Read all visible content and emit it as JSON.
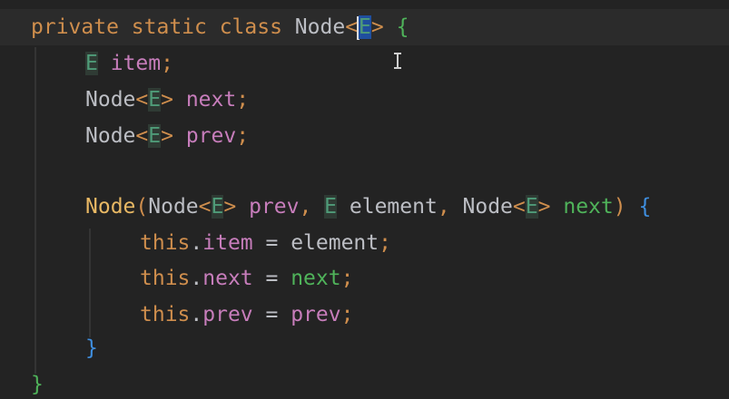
{
  "editor": {
    "lines": [
      [
        {
          "t": "private static class ",
          "c": "kw"
        },
        {
          "t": "Node",
          "c": "typ"
        },
        {
          "t": "<",
          "c": "lt"
        },
        {
          "t": "E",
          "c": "gen-sel"
        },
        {
          "t": ">",
          "c": "lt"
        },
        {
          "t": " ",
          "c": "typ"
        },
        {
          "t": "{",
          "c": "brace-g"
        }
      ],
      [
        {
          "t": "E",
          "c": "gen"
        },
        {
          "t": " ",
          "c": "typ"
        },
        {
          "t": "item",
          "c": "fld"
        },
        {
          "t": ";",
          "c": "punc"
        }
      ],
      [
        {
          "t": "Node",
          "c": "typ"
        },
        {
          "t": "<",
          "c": "lt"
        },
        {
          "t": "E",
          "c": "gen"
        },
        {
          "t": ">",
          "c": "lt"
        },
        {
          "t": " ",
          "c": "typ"
        },
        {
          "t": "next",
          "c": "fld"
        },
        {
          "t": ";",
          "c": "punc"
        }
      ],
      [
        {
          "t": "Node",
          "c": "typ"
        },
        {
          "t": "<",
          "c": "lt"
        },
        {
          "t": "E",
          "c": "gen"
        },
        {
          "t": ">",
          "c": "lt"
        },
        {
          "t": " ",
          "c": "typ"
        },
        {
          "t": "prev",
          "c": "fld"
        },
        {
          "t": ";",
          "c": "punc"
        }
      ],
      [],
      [
        {
          "t": "Node",
          "c": "fn"
        },
        {
          "t": "(",
          "c": "punc"
        },
        {
          "t": "Node",
          "c": "typ"
        },
        {
          "t": "<",
          "c": "lt"
        },
        {
          "t": "E",
          "c": "gen"
        },
        {
          "t": ">",
          "c": "lt"
        },
        {
          "t": " ",
          "c": "typ"
        },
        {
          "t": "prev",
          "c": "fld"
        },
        {
          "t": ", ",
          "c": "punc"
        },
        {
          "t": "E",
          "c": "gen"
        },
        {
          "t": " element",
          "c": "param"
        },
        {
          "t": ", ",
          "c": "punc"
        },
        {
          "t": "Node",
          "c": "typ"
        },
        {
          "t": "<",
          "c": "lt"
        },
        {
          "t": "E",
          "c": "gen"
        },
        {
          "t": ">",
          "c": "lt"
        },
        {
          "t": " ",
          "c": "typ"
        },
        {
          "t": "next",
          "c": "param-used"
        },
        {
          "t": ")",
          "c": "punc"
        },
        {
          "t": " ",
          "c": "typ"
        },
        {
          "t": "{",
          "c": "brace-b"
        }
      ],
      [
        {
          "t": "this",
          "c": "this"
        },
        {
          "t": ".",
          "c": "typ"
        },
        {
          "t": "item",
          "c": "fld"
        },
        {
          "t": " = ",
          "c": "typ"
        },
        {
          "t": "element",
          "c": "var"
        },
        {
          "t": ";",
          "c": "punc"
        }
      ],
      [
        {
          "t": "this",
          "c": "this"
        },
        {
          "t": ".",
          "c": "typ"
        },
        {
          "t": "next",
          "c": "fld"
        },
        {
          "t": " = ",
          "c": "typ"
        },
        {
          "t": "next",
          "c": "param-used"
        },
        {
          "t": ";",
          "c": "punc"
        }
      ],
      [
        {
          "t": "this",
          "c": "this"
        },
        {
          "t": ".",
          "c": "typ"
        },
        {
          "t": "prev",
          "c": "fld"
        },
        {
          "t": " = ",
          "c": "typ"
        },
        {
          "t": "prev",
          "c": "fld"
        },
        {
          "t": ";",
          "c": "punc"
        }
      ],
      [
        {
          "t": "}",
          "c": "brace-b"
        }
      ],
      [
        {
          "t": "}",
          "c": "brace-g"
        }
      ]
    ]
  },
  "colors": {
    "background": "#232323",
    "keyword": "#cf8e4d",
    "field": "#c77dbb",
    "generic": "#4f9b78",
    "selection": "#1f4f9e"
  }
}
